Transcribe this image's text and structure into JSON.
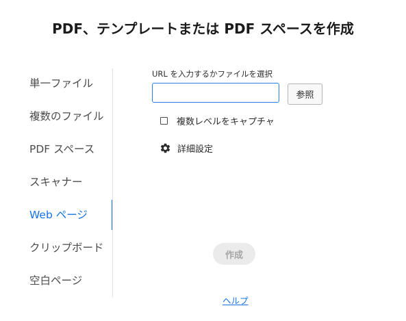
{
  "dialog": {
    "title": "PDF、テンプレートまたは PDF スペースを作成"
  },
  "sidebar": {
    "items": [
      {
        "label": "単一ファイル",
        "active": false
      },
      {
        "label": "複数のファイル",
        "active": false
      },
      {
        "label": "PDF スペース",
        "active": false
      },
      {
        "label": "スキャナー",
        "active": false
      },
      {
        "label": "Web ページ",
        "active": true
      },
      {
        "label": "クリップボード",
        "active": false
      },
      {
        "label": "空白ページ",
        "active": false
      }
    ]
  },
  "main": {
    "url_label": "URL を入力するかファイルを選択",
    "url_value": "",
    "browse_label": "参照",
    "capture_levels_label": "複数レベルをキャプチャ",
    "capture_levels_checked": false,
    "advanced_settings_label": "詳細設定",
    "create_label": "作成",
    "help_label": "ヘルプ"
  },
  "colors": {
    "accent": "#1473e6",
    "input_border": "#2680eb",
    "disabled_bg": "#ebebeb",
    "disabled_text": "#a6a6a6"
  },
  "icons": {
    "advanced_settings": "gear-icon",
    "capture_levels": "checkbox-unchecked"
  }
}
